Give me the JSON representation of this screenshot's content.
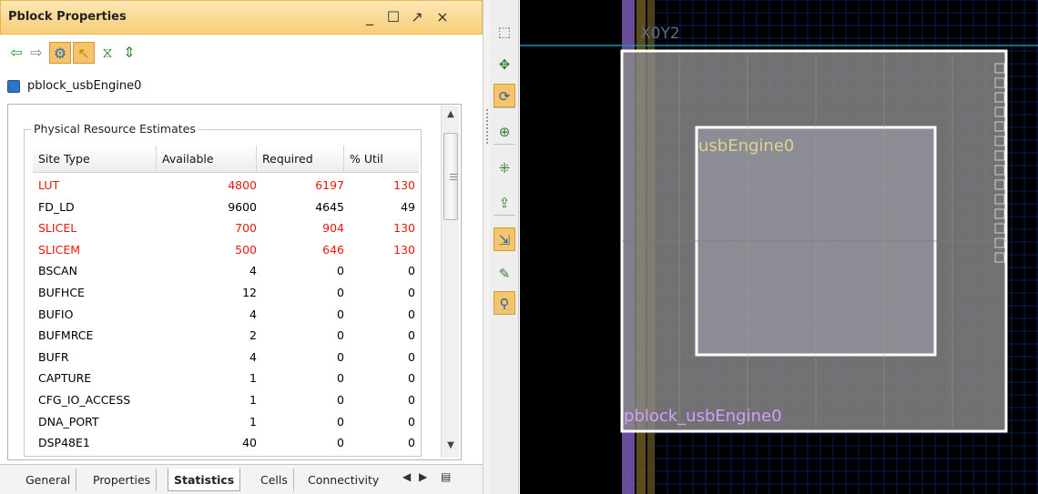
{
  "panel": {
    "title": "Pblock Properties",
    "window_controls": [
      "_",
      "☐",
      "↗",
      "×"
    ],
    "toolbar": [
      {
        "icon": "back-arrow-icon",
        "glyph": "⇦",
        "color": "#2b9a2b",
        "active": false
      },
      {
        "icon": "forward-arrow-icon",
        "glyph": "⇨",
        "color": "#8a8a8a",
        "active": false
      },
      {
        "icon": "gear-icon",
        "glyph": "⚙",
        "color": "#2e6fb0",
        "active": true
      },
      {
        "icon": "select-arrow-icon",
        "glyph": "↖",
        "color": "#c08a00",
        "active": true
      },
      {
        "icon": "collapse-icon",
        "glyph": "⧖",
        "color": "#3a8a3a",
        "active": false
      },
      {
        "icon": "expand-icon",
        "glyph": "⇕",
        "color": "#3a8a3a",
        "active": false
      }
    ],
    "object_name": "pblock_usbEngine0",
    "group_title": "Physical Resource Estimates",
    "columns": [
      "Site Type",
      "Available",
      "Required",
      "% Util"
    ],
    "rows": [
      {
        "site": "LUT",
        "available": "4800",
        "required": "6197",
        "util": "130",
        "over": true
      },
      {
        "site": "FD_LD",
        "available": "9600",
        "required": "4645",
        "util": "49",
        "over": false
      },
      {
        "site": "SLICEL",
        "available": "700",
        "required": "904",
        "util": "130",
        "over": true
      },
      {
        "site": "SLICEM",
        "available": "500",
        "required": "646",
        "util": "130",
        "over": true
      },
      {
        "site": "BSCAN",
        "available": "4",
        "required": "0",
        "util": "0",
        "over": false
      },
      {
        "site": "BUFHCE",
        "available": "12",
        "required": "0",
        "util": "0",
        "over": false
      },
      {
        "site": "BUFIO",
        "available": "4",
        "required": "0",
        "util": "0",
        "over": false
      },
      {
        "site": "BUFMRCE",
        "available": "2",
        "required": "0",
        "util": "0",
        "over": false
      },
      {
        "site": "BUFR",
        "available": "4",
        "required": "0",
        "util": "0",
        "over": false
      },
      {
        "site": "CAPTURE",
        "available": "1",
        "required": "0",
        "util": "0",
        "over": false
      },
      {
        "site": "CFG_IO_ACCESS",
        "available": "1",
        "required": "0",
        "util": "0",
        "over": false
      },
      {
        "site": "DNA_PORT",
        "available": "1",
        "required": "0",
        "util": "0",
        "over": false
      },
      {
        "site": "DSP48E1",
        "available": "40",
        "required": "0",
        "util": "0",
        "over": false
      }
    ],
    "tabs": [
      {
        "label": "General",
        "active": false
      },
      {
        "label": "Properties",
        "active": false
      },
      {
        "label": "Statistics",
        "active": true
      },
      {
        "label": "Cells",
        "active": false
      },
      {
        "label": "Connectivity",
        "active": false
      }
    ],
    "tab_nav": [
      "◀",
      "▶",
      "▤"
    ]
  },
  "device_toolbar": [
    {
      "icon": "select-area-icon",
      "glyph": "⬚",
      "active": false
    },
    {
      "icon": "fit-selection-icon",
      "glyph": "✥",
      "active": false
    },
    {
      "icon": "auto-fit-icon",
      "glyph": "⟳",
      "active": true
    },
    {
      "icon": "create-pblock-icon",
      "glyph": "⊕",
      "active": false
    },
    {
      "icon": "drag-pblock-icon",
      "glyph": "⁜",
      "active": false
    },
    {
      "icon": "move-pblock-icon",
      "glyph": "⇪",
      "active": false
    },
    {
      "icon": "place-cells-icon",
      "glyph": "⇲",
      "active": true
    },
    {
      "icon": "route-icon",
      "glyph": "✎",
      "active": false
    },
    {
      "icon": "search-highlight-icon",
      "glyph": "⚲",
      "active": true
    }
  ],
  "device_view": {
    "clock_region_label": "X0Y2",
    "cell_label": "usbEngine0",
    "pblock_label": "pblock_usbEngine0",
    "colors": {
      "background": "#000000",
      "pblock_fill": "#8a8a8a",
      "pblock_border": "#ffffff",
      "cell_label": "#e0d48c",
      "pblock_label": "#d79cff",
      "grid": "#0a1a55",
      "io_column": "#7a5ab0"
    }
  }
}
